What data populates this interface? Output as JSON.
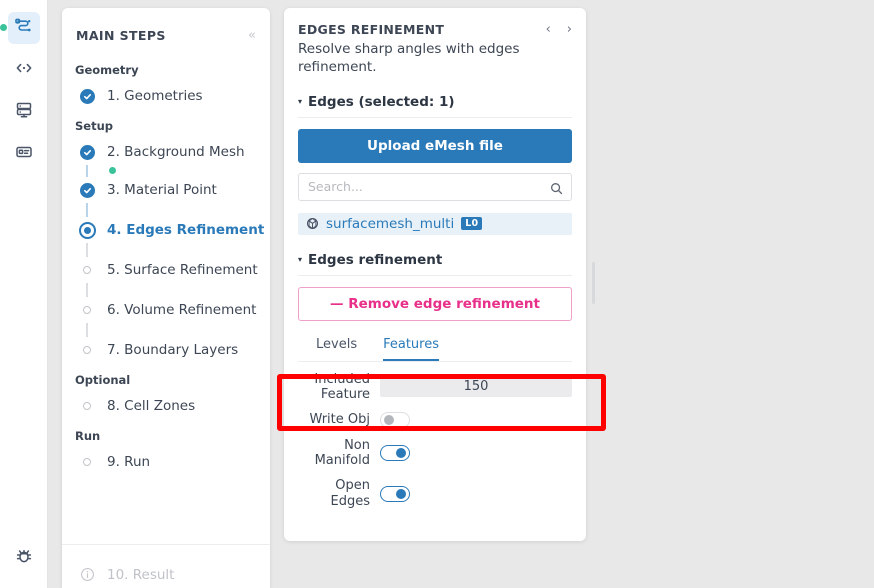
{
  "rail": {
    "items": [
      {
        "name": "workflow-icon",
        "active": true,
        "status_dot": true
      },
      {
        "name": "code-icon",
        "active": false,
        "status_dot": false
      },
      {
        "name": "server-icon",
        "active": false,
        "status_dot": false
      },
      {
        "name": "card-icon",
        "active": false,
        "status_dot": false
      }
    ],
    "bottom": {
      "name": "bug-icon"
    }
  },
  "steps": {
    "title": "MAIN STEPS",
    "collapse_label": "«",
    "groups": [
      {
        "label": "Geometry",
        "items": [
          {
            "label": "1. Geometries",
            "state": "done"
          }
        ]
      },
      {
        "label": "Setup",
        "items": [
          {
            "label": "2. Background Mesh",
            "state": "done",
            "sub_dot": true
          },
          {
            "label": "3. Material Point",
            "state": "done"
          },
          {
            "label": "4. Edges Refinement",
            "state": "current"
          },
          {
            "label": "5. Surface Refinement",
            "state": "todo"
          },
          {
            "label": "6. Volume Refinement",
            "state": "todo"
          },
          {
            "label": "7. Boundary Layers",
            "state": "todo"
          }
        ]
      },
      {
        "label": "Optional",
        "items": [
          {
            "label": "8. Cell Zones",
            "state": "todo"
          }
        ]
      },
      {
        "label": "Run",
        "items": [
          {
            "label": "9. Run",
            "state": "todo"
          }
        ]
      }
    ],
    "footer": {
      "label": "10. Result",
      "icon": "info-icon"
    }
  },
  "properties": {
    "title": "EDGES REFINEMENT",
    "description": "Resolve sharp angles with edges refinement.",
    "prev_label": "‹",
    "next_label": "›",
    "edges_section": {
      "caret": "▾",
      "title": "Edges (selected: 1)",
      "upload_label": "Upload eMesh file",
      "search_placeholder": "Search...",
      "search_value": "",
      "item": {
        "name": "surfacemesh_multi",
        "badge": "L0",
        "icon": "mesh-icon"
      }
    },
    "refinement_section": {
      "caret": "▾",
      "title": "Edges refinement",
      "remove_label": "—  Remove edge refinement"
    },
    "tabs": [
      {
        "label": "Levels",
        "active": false
      },
      {
        "label": "Features",
        "active": true
      }
    ],
    "fields": [
      {
        "label": "Included Feature",
        "type": "value",
        "value": "150"
      },
      {
        "label": "Write Obj",
        "type": "toggle",
        "on": false
      },
      {
        "label": "Non Manifold",
        "type": "toggle",
        "on": true
      },
      {
        "label": "Open Edges",
        "type": "toggle",
        "on": true
      }
    ]
  },
  "colors": {
    "accent_blue": "#2a7ab9",
    "accent_pink": "#e8308a",
    "status_green": "#3ac39a",
    "highlight_red": "#ff0000",
    "panel_bg": "#ffffff",
    "app_bg": "#e8e8e8"
  }
}
